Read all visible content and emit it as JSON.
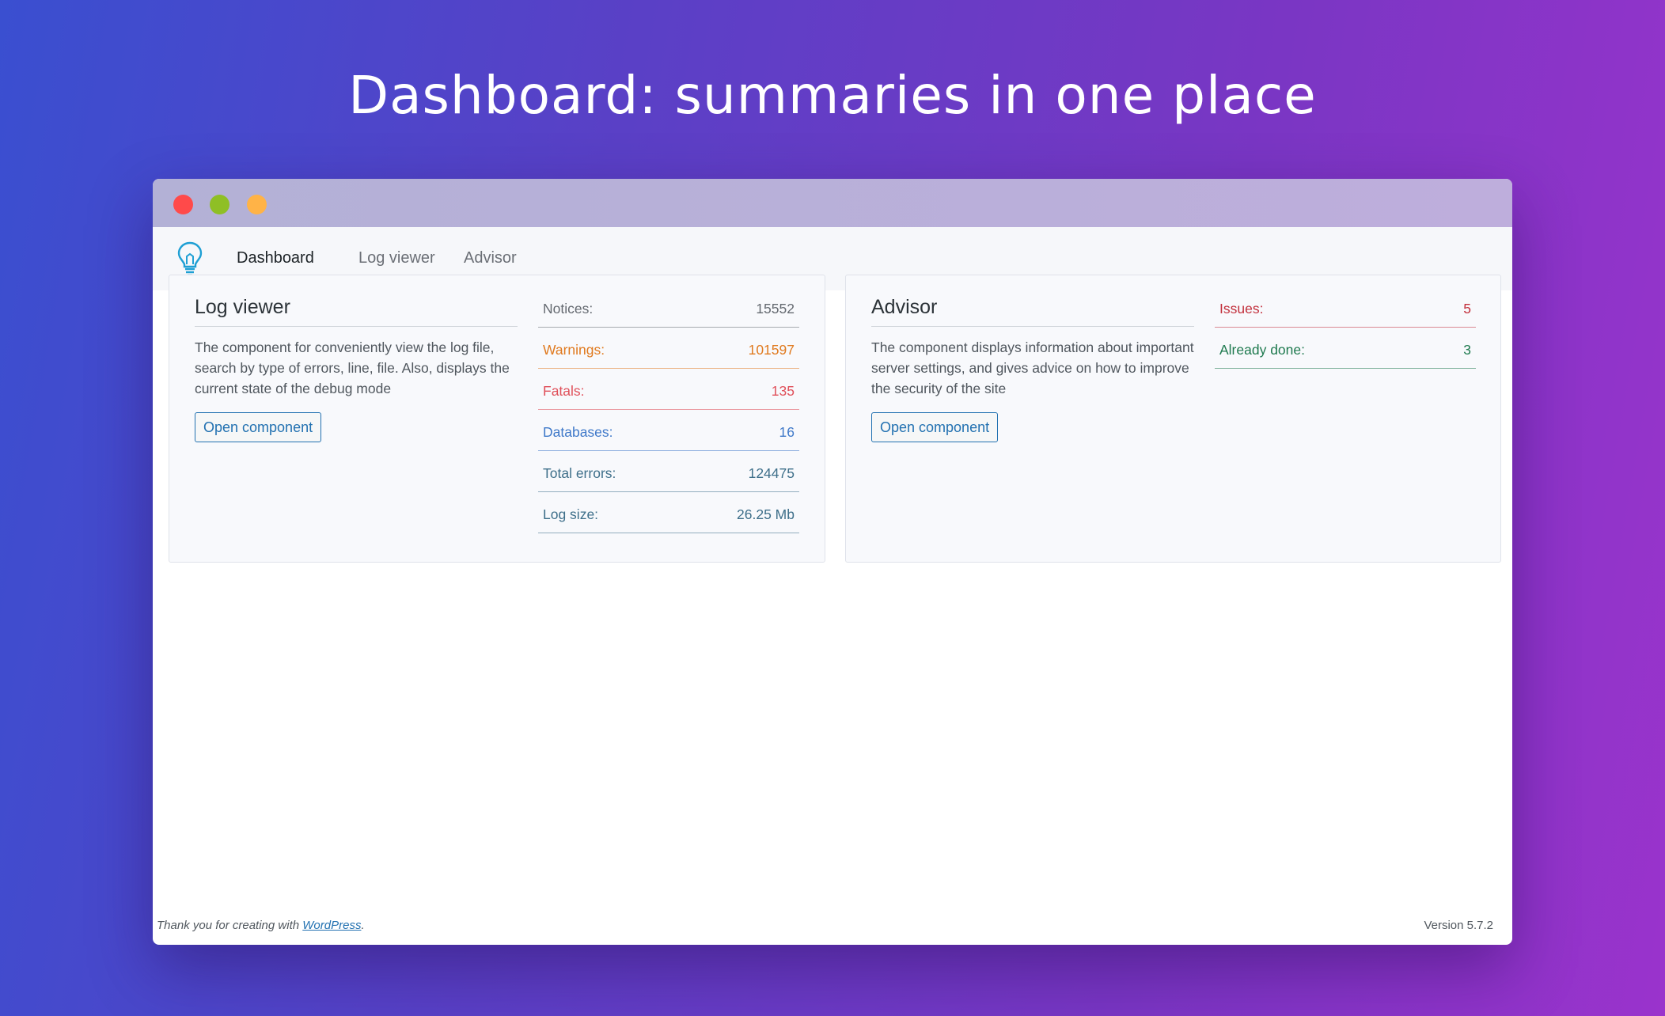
{
  "hero": {
    "title": "Dashboard: summaries in one place"
  },
  "nav": {
    "tabs": [
      {
        "label": "Dashboard",
        "active": true
      },
      {
        "label": "Log viewer",
        "active": false
      },
      {
        "label": "Advisor",
        "active": false
      }
    ]
  },
  "log_viewer": {
    "title": "Log viewer",
    "description": "The component for conveniently view the log file, search by type of errors, line, file. Also, displays the current state of the debug mode",
    "button_label": "Open component",
    "stats": [
      {
        "label": "Notices:",
        "value": "15552",
        "color": "#646970"
      },
      {
        "label": "Warnings:",
        "value": "101597",
        "color": "#e07a1f"
      },
      {
        "label": "Fatals:",
        "value": "135",
        "color": "#e0505a"
      },
      {
        "label": "Databases:",
        "value": "16",
        "color": "#3f79c9"
      },
      {
        "label": "Total errors:",
        "value": "124475",
        "color": "#3e6f8a"
      },
      {
        "label": "Log size:",
        "value": "26.25 Mb",
        "color": "#3e6f8a"
      }
    ]
  },
  "advisor": {
    "title": "Advisor",
    "description": "The component displays information about important server settings, and gives advice on how to improve the security of the site",
    "button_label": "Open component",
    "stats": [
      {
        "label": "Issues:",
        "value": "5",
        "color": "#c2303c"
      },
      {
        "label": "Already done:",
        "value": "3",
        "color": "#1f7a4f"
      }
    ]
  },
  "footer": {
    "thanks_prefix": "Thank you for creating with ",
    "thanks_link": "WordPress",
    "thanks_suffix": ".",
    "version": "Version 5.7.2"
  },
  "colors": {
    "accent": "#2271b1",
    "logo": "#1e9fd4"
  }
}
